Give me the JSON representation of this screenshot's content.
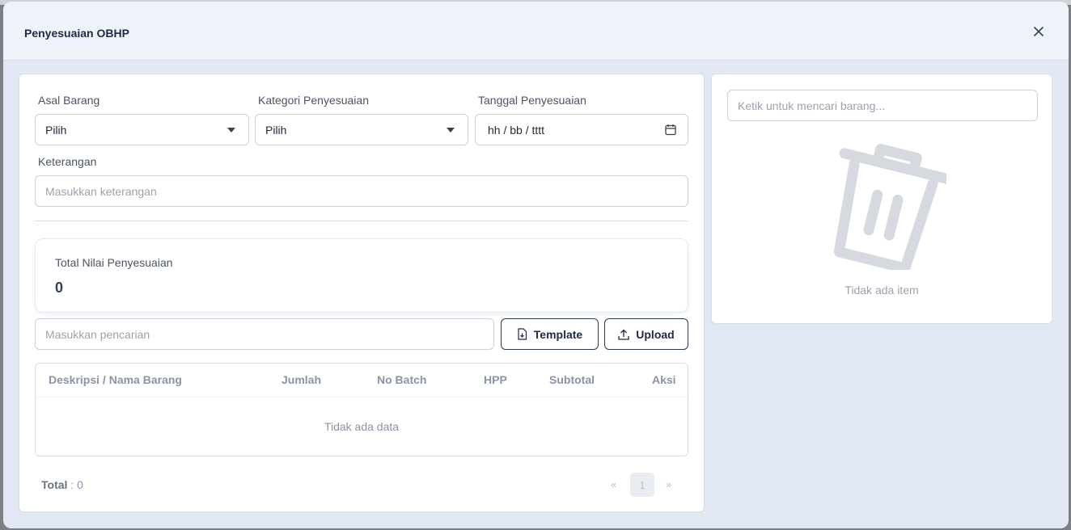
{
  "modal": {
    "title": "Penyesuaian OBHP",
    "close_icon": "close-icon"
  },
  "form": {
    "asal_barang": {
      "label": "Asal Barang",
      "value": "Pilih"
    },
    "kategori": {
      "label": "Kategori Penyesuaian",
      "value": "Pilih"
    },
    "tanggal": {
      "label": "Tanggal Penyesuaian",
      "value": "hh / bb / tttt"
    },
    "keterangan": {
      "label": "Keterangan",
      "placeholder": "Masukkan keterangan"
    }
  },
  "summary": {
    "label": "Total Nilai Penyesuaian",
    "value": "0"
  },
  "search": {
    "placeholder": "Masukkan pencarian"
  },
  "buttons": {
    "template": "Template",
    "upload": "Upload"
  },
  "table": {
    "headers": [
      "Deskripsi / Nama Barang",
      "Jumlah",
      "No Batch",
      "HPP",
      "Subtotal",
      "Aksi"
    ],
    "empty": "Tidak ada data"
  },
  "footer": {
    "total_label": "Total",
    "total_value": " : 0"
  },
  "pagination": {
    "prev": "«",
    "page": "1",
    "next": "»"
  },
  "right_panel": {
    "search_placeholder": "Ketik untuk mencari barang...",
    "empty": "Tidak ada item"
  }
}
